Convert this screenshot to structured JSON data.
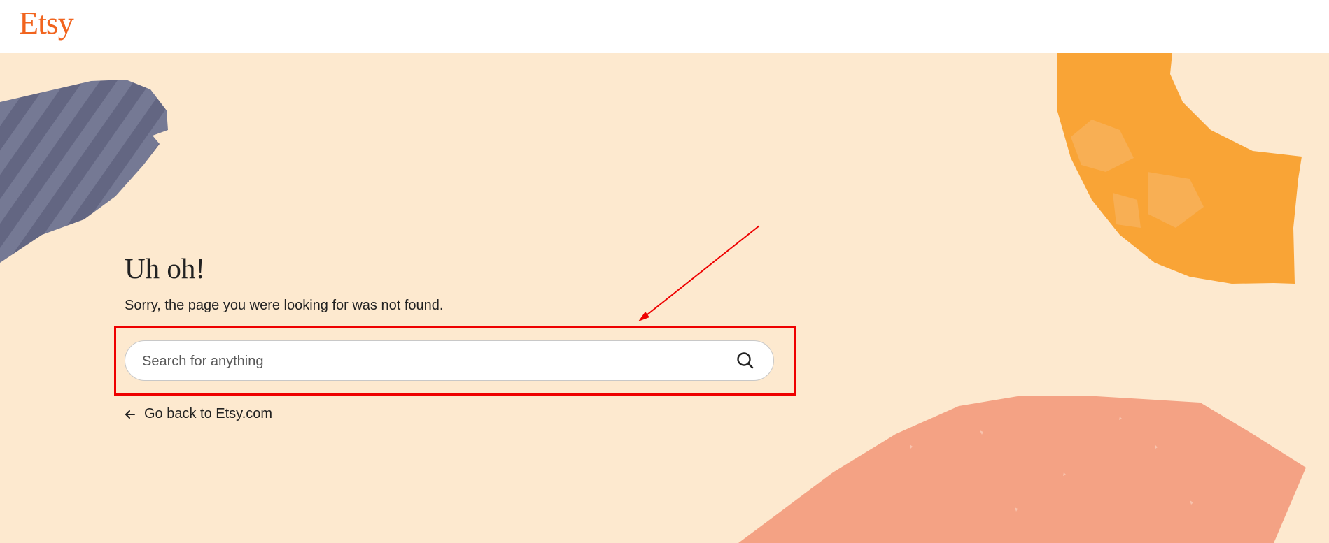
{
  "header": {
    "logo_text": "Etsy"
  },
  "error": {
    "heading": "Uh oh!",
    "message": "Sorry, the page you were looking for was not found."
  },
  "search": {
    "placeholder": "Search for anything",
    "value": ""
  },
  "back_link": {
    "label": "Go back to Etsy.com"
  },
  "colors": {
    "brand": "#f1641e",
    "background": "#fde9cf",
    "annotation": "#ee0000"
  }
}
